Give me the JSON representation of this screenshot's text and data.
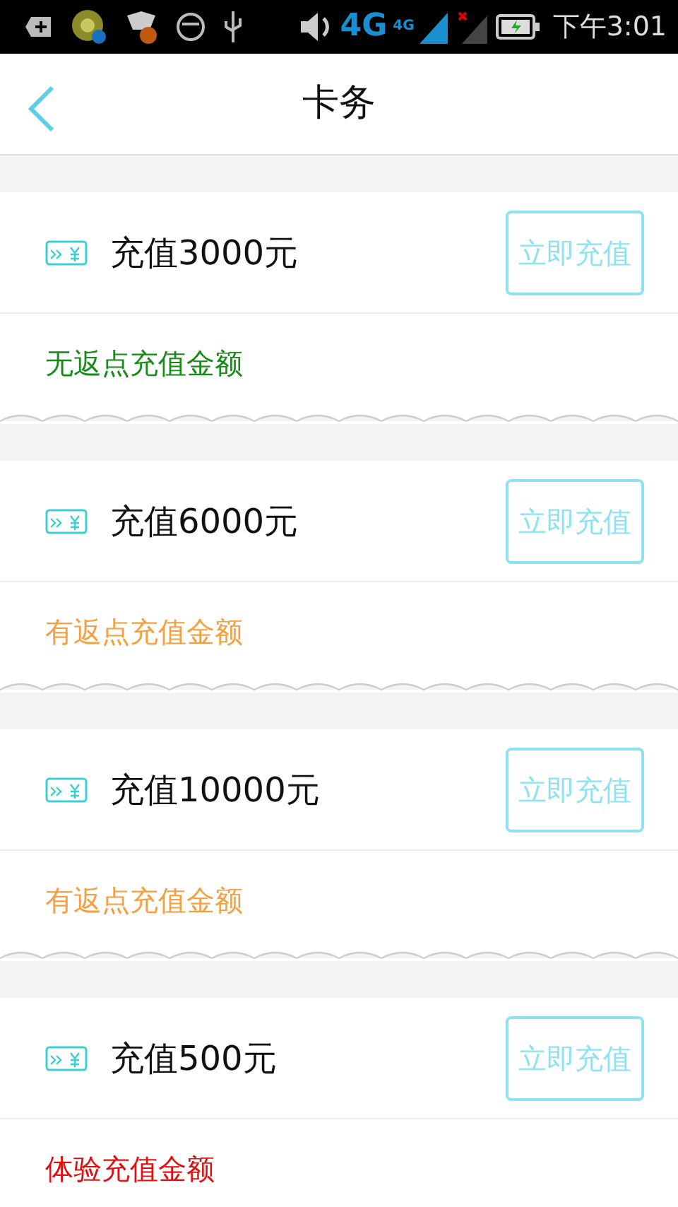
{
  "status_bar": {
    "network": "4G",
    "network_small": "4G",
    "time": "下午3:01"
  },
  "header": {
    "title": "卡务"
  },
  "cards": [
    {
      "title": "充值3000元",
      "button": "立即充值",
      "note": "无返点充值金额",
      "color": "#178a17"
    },
    {
      "title": "充值6000元",
      "button": "立即充值",
      "note": "有返点充值金额",
      "color": "#f5a040"
    },
    {
      "title": "充值10000元",
      "button": "立即充值",
      "note": "有返点充值金额",
      "color": "#f5a040"
    },
    {
      "title": "充值500元",
      "button": "立即充值",
      "note": "体验充值金额",
      "color": "#e01010"
    }
  ]
}
